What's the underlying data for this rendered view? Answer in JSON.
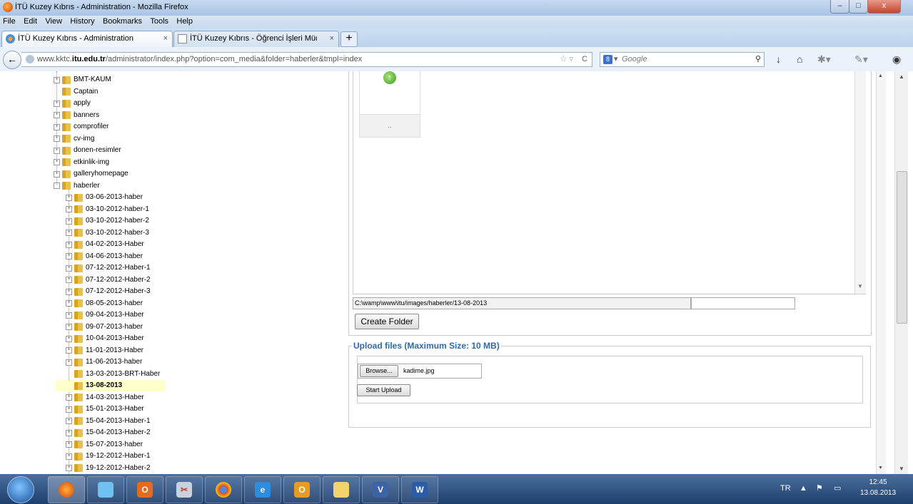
{
  "window": {
    "title": "İTÜ Kuzey Kıbrıs - Administration - Mozilla Firefox",
    "minimize": "–",
    "maximize": "□",
    "close": "x"
  },
  "menu": [
    "File",
    "Edit",
    "View",
    "History",
    "Bookmarks",
    "Tools",
    "Help"
  ],
  "tabs": [
    {
      "label": "İTÜ Kuzey Kıbrıs - Administration",
      "close": "×"
    },
    {
      "label": "İTÜ Kuzey Kıbrıs - Öğrenci İşleri Müd...",
      "close": "×"
    }
  ],
  "new_tab": "+",
  "url": {
    "prefix": "www.kktc.",
    "domain": "itu.edu.tr",
    "path": "/administrator/index.php?option=com_media&folder=haberler&tmpl=index",
    "star": "☆ ▿",
    "reload": "C"
  },
  "search": {
    "engine": "8",
    "placeholder": "Google"
  },
  "tree": {
    "top_level": [
      {
        "label": "BMT-KAUM",
        "expand": "+"
      },
      {
        "label": "Captain",
        "expand": ""
      },
      {
        "label": "apply",
        "expand": "+"
      },
      {
        "label": "banners",
        "expand": "+"
      },
      {
        "label": "comprofiler",
        "expand": "+"
      },
      {
        "label": "cv-img",
        "expand": "+"
      },
      {
        "label": "donen-resimler",
        "expand": "+"
      },
      {
        "label": "etkinlik-img",
        "expand": "+"
      },
      {
        "label": "galleryhomepage",
        "expand": "+"
      },
      {
        "label": "haberler",
        "expand": "-"
      }
    ],
    "children": [
      {
        "label": "03-06-2013-haber",
        "expand": "+"
      },
      {
        "label": "03-10-2012-haber-1",
        "expand": "+"
      },
      {
        "label": "03-10-2012-haber-2",
        "expand": "+"
      },
      {
        "label": "03-10-2012-haber-3",
        "expand": "+"
      },
      {
        "label": "04-02-2013-Haber",
        "expand": "+"
      },
      {
        "label": "04-06-2013-haber",
        "expand": "+"
      },
      {
        "label": "07-12-2012-Haber-1",
        "expand": "+"
      },
      {
        "label": "07-12-2012-Haber-2",
        "expand": "+"
      },
      {
        "label": "07-12-2012-Haber-3",
        "expand": "+"
      },
      {
        "label": "08-05-2013-haber",
        "expand": "+"
      },
      {
        "label": "09-04-2013-Haber",
        "expand": "+"
      },
      {
        "label": "09-07-2013-haber",
        "expand": "+"
      },
      {
        "label": "10-04-2013-Haber",
        "expand": "+"
      },
      {
        "label": "11-01-2013-Haber",
        "expand": "+"
      },
      {
        "label": "11-06-2013-haber",
        "expand": "+"
      },
      {
        "label": "13-03-2013-BRT-Haber",
        "expand": ""
      },
      {
        "label": "13-08-2013",
        "expand": "",
        "selected": true
      },
      {
        "label": "14-03-2013-Haber",
        "expand": "+"
      },
      {
        "label": "15-01-2013-Haber",
        "expand": "+"
      },
      {
        "label": "15-04-2013-Haber-1",
        "expand": "+"
      },
      {
        "label": "15-04-2013-Haber-2",
        "expand": "+"
      },
      {
        "label": "15-07-2013-haber",
        "expand": "+"
      },
      {
        "label": "19-12-2012-Haber-1",
        "expand": "+"
      },
      {
        "label": "19-12-2012-Haber-2",
        "expand": "+"
      }
    ]
  },
  "filebrowser": {
    "parent_caption": "..",
    "up_arrow": "↑",
    "path_value": "C:\\wamp\\www\\itu/images/haberler/13-08-2013",
    "folder_name_value": "",
    "create_folder": "Create Folder"
  },
  "upload": {
    "legend": "Upload files (Maximum Size: 10 MB)",
    "browse": "Browse...",
    "file_name": "kadime.jpg",
    "start": "Start Upload"
  },
  "taskbar": {
    "lang": "TR",
    "time": "12:45",
    "date": "13.08.2013",
    "apps": [
      "firefox",
      "folder",
      "media",
      "snipping",
      "chrome",
      "ie",
      "outlook",
      "explorer",
      "visio",
      "word"
    ]
  },
  "colors": {
    "accent": "#2f6aa8",
    "selected_bg": "#ffffcc",
    "folder": "#d6a41e"
  }
}
